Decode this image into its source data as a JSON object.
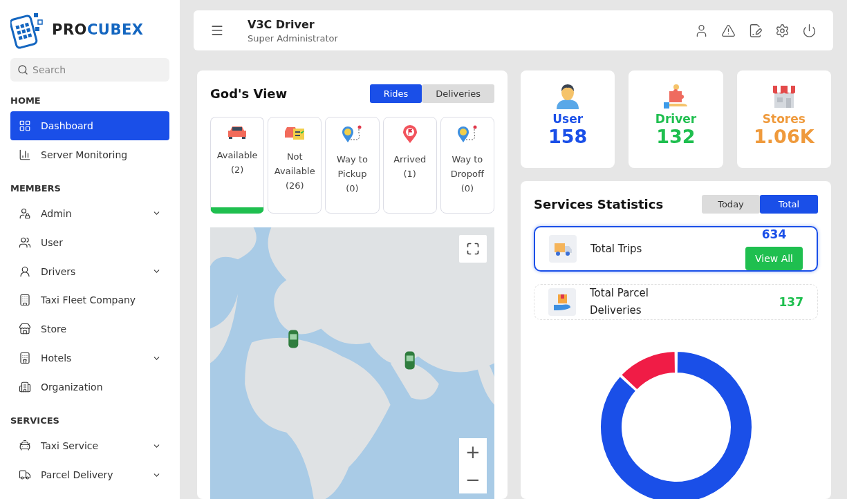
{
  "brand": {
    "name_dark": "PRO",
    "name_accent": "CUBEX"
  },
  "search": {
    "placeholder": "Search"
  },
  "sidebar": {
    "sections": [
      {
        "title": "HOME",
        "items": [
          {
            "label": "Dashboard",
            "selected": true,
            "expandable": false
          },
          {
            "label": "Server Monitoring",
            "selected": false,
            "expandable": false
          }
        ]
      },
      {
        "title": "MEMBERS",
        "items": [
          {
            "label": "Admin",
            "selected": false,
            "expandable": true
          },
          {
            "label": "User",
            "selected": false,
            "expandable": false
          },
          {
            "label": "Drivers",
            "selected": false,
            "expandable": true
          },
          {
            "label": "Taxi Fleet Company",
            "selected": false,
            "expandable": false
          },
          {
            "label": "Store",
            "selected": false,
            "expandable": false
          },
          {
            "label": "Hotels",
            "selected": false,
            "expandable": true
          },
          {
            "label": "Organization",
            "selected": false,
            "expandable": false
          }
        ]
      },
      {
        "title": "SERVICES",
        "items": [
          {
            "label": "Taxi Service",
            "selected": false,
            "expandable": true
          },
          {
            "label": "Parcel Delivery",
            "selected": false,
            "expandable": true
          }
        ]
      }
    ]
  },
  "header": {
    "title": "V3C Driver",
    "subtitle": "Super Administrator"
  },
  "gods_view": {
    "title": "God's View",
    "tabs": [
      {
        "label": "Rides",
        "selected": true
      },
      {
        "label": "Deliveries",
        "selected": false
      }
    ],
    "statuses": [
      {
        "kind": "car",
        "label": "Available",
        "count": "(2)",
        "selected": true
      },
      {
        "kind": "car-list",
        "label": "Not Available",
        "count": "(26)",
        "selected": false
      },
      {
        "kind": "route",
        "label": "Way to Pickup",
        "count": "(0)",
        "selected": false
      },
      {
        "kind": "flag",
        "label": "Arrived",
        "count": "(1)",
        "selected": false
      },
      {
        "kind": "route",
        "label": "Way to Dropoff",
        "count": "(0)",
        "selected": false
      }
    ],
    "map": {
      "kind": "picture",
      "zoom_in": "+",
      "zoom_out": "−"
    }
  },
  "stats": [
    {
      "kind": "user",
      "label": "User",
      "value": "158",
      "color": "#1a4fe8"
    },
    {
      "kind": "driver",
      "label": "Driver",
      "value": "132",
      "color": "#1fbf4f"
    },
    {
      "kind": "store",
      "label": "Stores",
      "value": "1.06K",
      "color": "#ef9a3c"
    }
  ],
  "services": {
    "title": "Services Statistics",
    "tabs": [
      {
        "label": "Today",
        "selected": false
      },
      {
        "label": "Total",
        "selected": true
      }
    ],
    "items": [
      {
        "kind": "trips",
        "label": "Total Trips",
        "value": "634",
        "color": "#1a4fe8",
        "selected": true,
        "button": "View All"
      },
      {
        "kind": "parcel",
        "label": "Total Parcel Deliveries",
        "value": "137",
        "color": "#1fbf4f",
        "selected": false
      }
    ]
  }
}
